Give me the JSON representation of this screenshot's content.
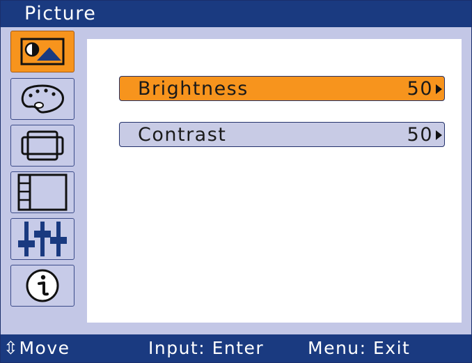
{
  "window": {
    "title": "Picture"
  },
  "sidebar": {
    "tabs": [
      {
        "icon": "picture-icon",
        "active": true
      },
      {
        "icon": "color-palette-icon",
        "active": false
      },
      {
        "icon": "position-icon",
        "active": false
      },
      {
        "icon": "display-setup-icon",
        "active": false
      },
      {
        "icon": "adjustment-sliders-icon",
        "active": false
      },
      {
        "icon": "info-icon",
        "active": false
      }
    ]
  },
  "menu": {
    "items": [
      {
        "label": "Brightness",
        "value": "50",
        "selected": true
      },
      {
        "label": "Contrast",
        "value": "50",
        "selected": false
      }
    ]
  },
  "footer": {
    "move": "⇳Move",
    "input": "Input: Enter",
    "menu": "Menu: Exit"
  },
  "colors": {
    "title_bar": "#1a3a80",
    "highlight": "#f7941d",
    "panel": "#c3c7e6",
    "content": "#ffffff"
  }
}
